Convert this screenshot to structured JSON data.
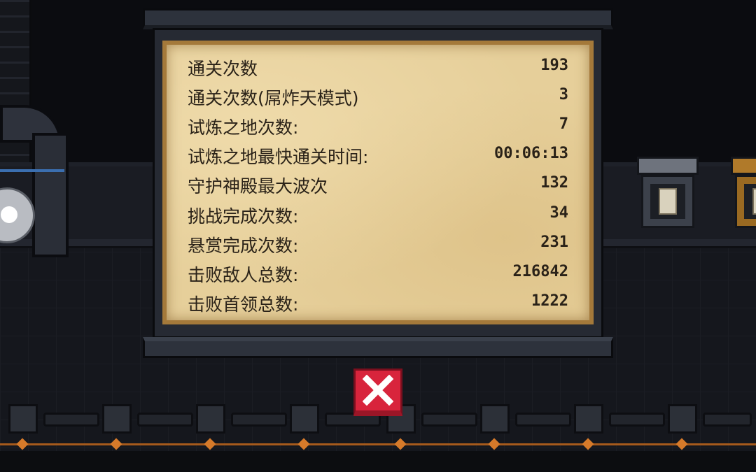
{
  "stats": [
    {
      "label": "通关次数",
      "value": "193"
    },
    {
      "label": "通关次数(屌炸天模式)",
      "value": "3"
    },
    {
      "label": "试炼之地次数:",
      "value": "7"
    },
    {
      "label": "试炼之地最快通关时间:",
      "value": "00:06:13"
    },
    {
      "label": "守护神殿最大波次",
      "value": "132"
    },
    {
      "label": "挑战完成次数:",
      "value": "34"
    },
    {
      "label": "悬赏完成次数:",
      "value": "231"
    },
    {
      "label": "击败敌人总数:",
      "value": "216842"
    },
    {
      "label": "击败首领总数:",
      "value": "1222"
    }
  ],
  "close_button": {
    "icon": "close-icon",
    "color": "#d8243c"
  },
  "colors": {
    "parchment": "#e6cf9a",
    "text": "#2a2218",
    "frame": "#262a33",
    "accent_rail": "#a65a1c"
  }
}
